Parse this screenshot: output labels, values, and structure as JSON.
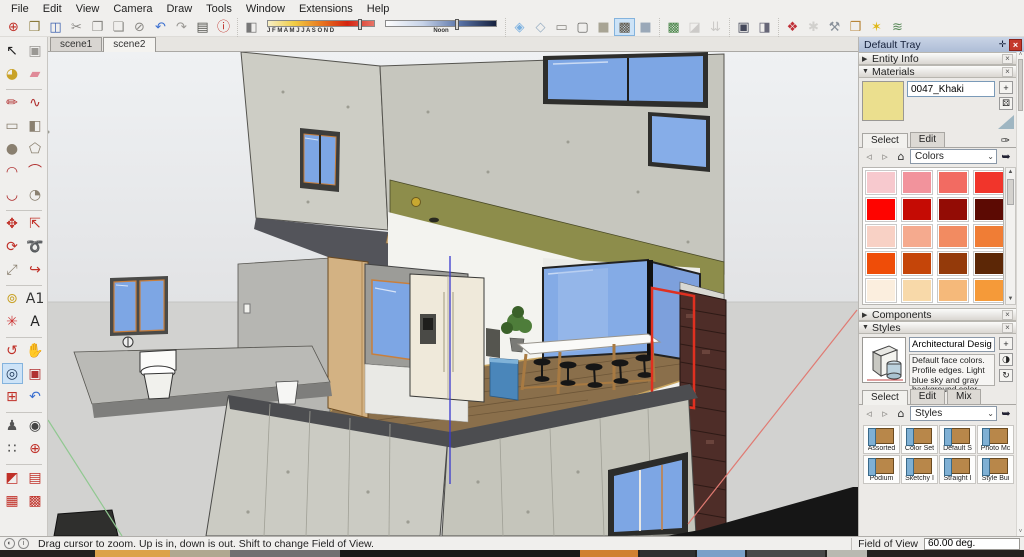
{
  "menu": {
    "items": [
      "File",
      "Edit",
      "View",
      "Camera",
      "Draw",
      "Tools",
      "Window",
      "Extensions",
      "Help"
    ]
  },
  "toolbar": {
    "standard": [
      {
        "name": "new-button",
        "glyph": "⊕",
        "color": "#c03028"
      },
      {
        "name": "open-button",
        "glyph": "❒",
        "color": "#8a7a3a"
      },
      {
        "name": "save-button",
        "glyph": "◫",
        "color": "#3a5fae"
      },
      {
        "name": "cut-button",
        "glyph": "✂",
        "color": "#8a8884"
      },
      {
        "name": "copy-button",
        "glyph": "❐",
        "color": "#8a8884"
      },
      {
        "name": "paste-button",
        "glyph": "❏",
        "color": "#8a8884"
      },
      {
        "name": "erase-button",
        "glyph": "⊘",
        "color": "#8a8884"
      },
      {
        "name": "undo-button",
        "glyph": "↶",
        "color": "#3a6fd0"
      },
      {
        "name": "redo-button",
        "glyph": "↷",
        "color": "#9a9894"
      },
      {
        "name": "print-button",
        "glyph": "▤",
        "color": "#555550"
      },
      {
        "name": "model-info-button",
        "glyph": "ⓘ",
        "color": "#c03028"
      }
    ],
    "shadow_toggle_glyph": "◧",
    "months": "J F M A M J J A S O N D",
    "time_label": "Noon",
    "face_styles": [
      {
        "name": "xray-mode-button",
        "glyph": "◈",
        "color": "#7ab0e0"
      },
      {
        "name": "back-edges-button",
        "glyph": "◇",
        "color": "#9ab0c4"
      },
      {
        "name": "wireframe-button",
        "glyph": "▭",
        "color": "#8a8884"
      },
      {
        "name": "hidden-line-button",
        "glyph": "▢",
        "color": "#6a6a66"
      },
      {
        "name": "shaded-button",
        "glyph": "■",
        "color": "#a8a494"
      },
      {
        "name": "shaded-with-textures-button",
        "glyph": "▩",
        "color": "#5a5040",
        "active": true
      },
      {
        "name": "monochrome-button",
        "glyph": "■",
        "color": "#9aa8b8"
      }
    ],
    "location": [
      {
        "name": "add-location-button",
        "glyph": "▩",
        "color": "#3f7f3f"
      },
      {
        "name": "toggle-terrain-button",
        "glyph": "◪",
        "color": "#8a8884",
        "disabled": true
      },
      {
        "name": "photo-textures-button",
        "glyph": "⇊",
        "color": "#8a8884",
        "disabled": true
      }
    ],
    "photo": [
      {
        "name": "match-photo-button",
        "glyph": "▣",
        "color": "#44485a"
      },
      {
        "name": "texture-image-button",
        "glyph": "◨",
        "color": "#667"
      }
    ],
    "browsers": [
      {
        "name": "materials-browser-button",
        "glyph": "❖",
        "color": "#c03038"
      },
      {
        "name": "styles-gear-button",
        "glyph": "✱",
        "color": "#9a9894",
        "disabled": true
      },
      {
        "name": "wrench-tool-button",
        "glyph": "⚒",
        "color": "#88909a"
      },
      {
        "name": "component-browser-button",
        "glyph": "❒",
        "color": "#b8863a"
      },
      {
        "name": "light-bulb-button",
        "glyph": "✶",
        "color": "#e0b818"
      },
      {
        "name": "sandbox-tool-button",
        "glyph": "≋",
        "color": "#5a8a5a"
      }
    ]
  },
  "scene_tabs": [
    {
      "label": "scene1",
      "name": "tab-scene1"
    },
    {
      "label": "scene2",
      "name": "tab-scene2",
      "active": true
    }
  ],
  "tools": {
    "items": [
      {
        "name": "select-tool",
        "glyph": "↖",
        "color": "#222"
      },
      {
        "name": "make-component-tool",
        "glyph": "▣",
        "color": "#9a9894"
      },
      {
        "name": "paint-bucket-tool",
        "glyph": "◕",
        "color": "#c9a227"
      },
      {
        "name": "eraser-tool",
        "glyph": "▰",
        "color": "#e08a98"
      },
      {
        "sep": true
      },
      {
        "name": "line-tool",
        "glyph": "✏",
        "color": "#b03030"
      },
      {
        "name": "freehand-tool",
        "glyph": "∿",
        "color": "#b03030"
      },
      {
        "name": "rectangle-tool",
        "glyph": "▭",
        "color": "#8a8070"
      },
      {
        "name": "rotated-rectangle-tool",
        "glyph": "◧",
        "color": "#8a8070"
      },
      {
        "name": "circle-tool",
        "glyph": "●",
        "color": "#8a8070"
      },
      {
        "name": "polygon-tool",
        "glyph": "⬠",
        "color": "#8a8070"
      },
      {
        "name": "arc-tool",
        "glyph": "◠",
        "color": "#b03030"
      },
      {
        "name": "two-point-arc-tool",
        "glyph": "⌒",
        "color": "#b03030"
      },
      {
        "name": "three-point-arc-tool",
        "glyph": "◡",
        "color": "#b03030"
      },
      {
        "name": "pie-tool",
        "glyph": "◔",
        "color": "#8a8070"
      },
      {
        "sep": true
      },
      {
        "name": "move-tool",
        "glyph": "✥",
        "color": "#c03028"
      },
      {
        "name": "push-pull-tool",
        "glyph": "⇱",
        "color": "#c03028"
      },
      {
        "name": "rotate-tool",
        "glyph": "⟳",
        "color": "#c03028"
      },
      {
        "name": "follow-me-tool",
        "glyph": "➰",
        "color": "#444"
      },
      {
        "name": "scale-tool",
        "glyph": "⤢",
        "color": "#8a8070"
      },
      {
        "name": "offset-tool",
        "glyph": "↪",
        "color": "#c03028"
      },
      {
        "sep": true
      },
      {
        "name": "tape-measure-tool",
        "glyph": "⊚",
        "color": "#c9a227"
      },
      {
        "name": "text-tool",
        "glyph": "A1",
        "color": "#333"
      },
      {
        "name": "axes-tool",
        "glyph": "✳",
        "color": "#cc3333"
      },
      {
        "name": "3d-text-tool",
        "glyph": "A",
        "color": "#222"
      },
      {
        "sep": true
      },
      {
        "name": "orbit-tool",
        "glyph": "↺",
        "color": "#c03028"
      },
      {
        "name": "pan-tool",
        "glyph": "✋",
        "color": "#c9a227"
      },
      {
        "name": "zoom-tool",
        "glyph": "◎",
        "color": "#223a5a",
        "active": true
      },
      {
        "name": "zoom-window-tool",
        "glyph": "▣",
        "color": "#b03030"
      },
      {
        "name": "zoom-extents-tool",
        "glyph": "⊞",
        "color": "#c03028"
      },
      {
        "name": "previous-view-tool",
        "glyph": "↶",
        "color": "#3a6fd0"
      },
      {
        "sep": true
      },
      {
        "name": "position-camera-tool",
        "glyph": "♟",
        "color": "#555"
      },
      {
        "name": "look-around-tool",
        "glyph": "◉",
        "color": "#444"
      },
      {
        "name": "walk-tool",
        "glyph": "∷",
        "color": "#444"
      },
      {
        "name": "camera-target-tool",
        "glyph": "⊕",
        "color": "#c03028"
      },
      {
        "sep": true
      },
      {
        "name": "section-plane-tool",
        "glyph": "◩",
        "color": "#c03028"
      },
      {
        "name": "section-display-toggle",
        "glyph": "▤",
        "color": "#c03028"
      },
      {
        "name": "section-cut-toggle",
        "glyph": "▦",
        "color": "#c03028"
      },
      {
        "name": "section-fill-toggle",
        "glyph": "▩",
        "color": "#c03028"
      }
    ]
  },
  "tray": {
    "title": "Default Tray",
    "pin_glyph": "✛",
    "close_glyph": "×",
    "entity_info": {
      "label": "Entity Info"
    },
    "materials": {
      "label": "Materials",
      "name": "0047_Khaki",
      "preview_color": "#ebdf8e",
      "create_glyph": "+",
      "secondary_glyph": "⚄",
      "eyedropper_glyph": "✑",
      "tabs": [
        {
          "label": "Select",
          "active": true
        },
        {
          "label": "Edit"
        }
      ],
      "back_glyph": "◃",
      "fwd_glyph": "▹",
      "home_glyph": "⌂",
      "detach_glyph": "➥",
      "collection": "Colors",
      "swatches": [
        "#f7c9ce",
        "#f2939c",
        "#f26b62",
        "#f1352b",
        "#fe0400",
        "#c50b04",
        "#930c05",
        "#5c0a03",
        "#f8d1c5",
        "#f5aa8e",
        "#f28b61",
        "#f07d35",
        "#ef4d08",
        "#c54509",
        "#943a0a",
        "#5c2706",
        "#fbeede",
        "#f8d9a9",
        "#f5b97a",
        "#f59a39",
        "#f98e02",
        "#c57c0a",
        "#94590a",
        "#5c3d04"
      ]
    },
    "components": {
      "label": "Components"
    },
    "styles": {
      "label": "Styles",
      "name": "Architectural Design Style",
      "description": "Default face colors. Profile edges. Light blue sky and gray background color.",
      "create_glyph": "+",
      "update_glyph": "◑",
      "refresh_glyph": "↻",
      "tabs": [
        {
          "label": "Select",
          "active": true
        },
        {
          "label": "Edit"
        },
        {
          "label": "Mix"
        }
      ],
      "collection": "Styles",
      "folders": [
        "Assorted",
        "Color Set",
        "Default S",
        "Photo Mc",
        "Podium",
        "Sketchy I",
        "Straight I",
        "Style Bui"
      ]
    }
  },
  "status": {
    "icons": [
      {
        "name": "geolocation-status-icon",
        "glyph": "◐"
      },
      {
        "name": "credits-status-icon",
        "glyph": "i"
      }
    ],
    "message": "Drag cursor to zoom.  Up is in, down is out. Shift to change Field of View.",
    "fov_label": "Field of View",
    "fov_value": "60.00 deg."
  }
}
